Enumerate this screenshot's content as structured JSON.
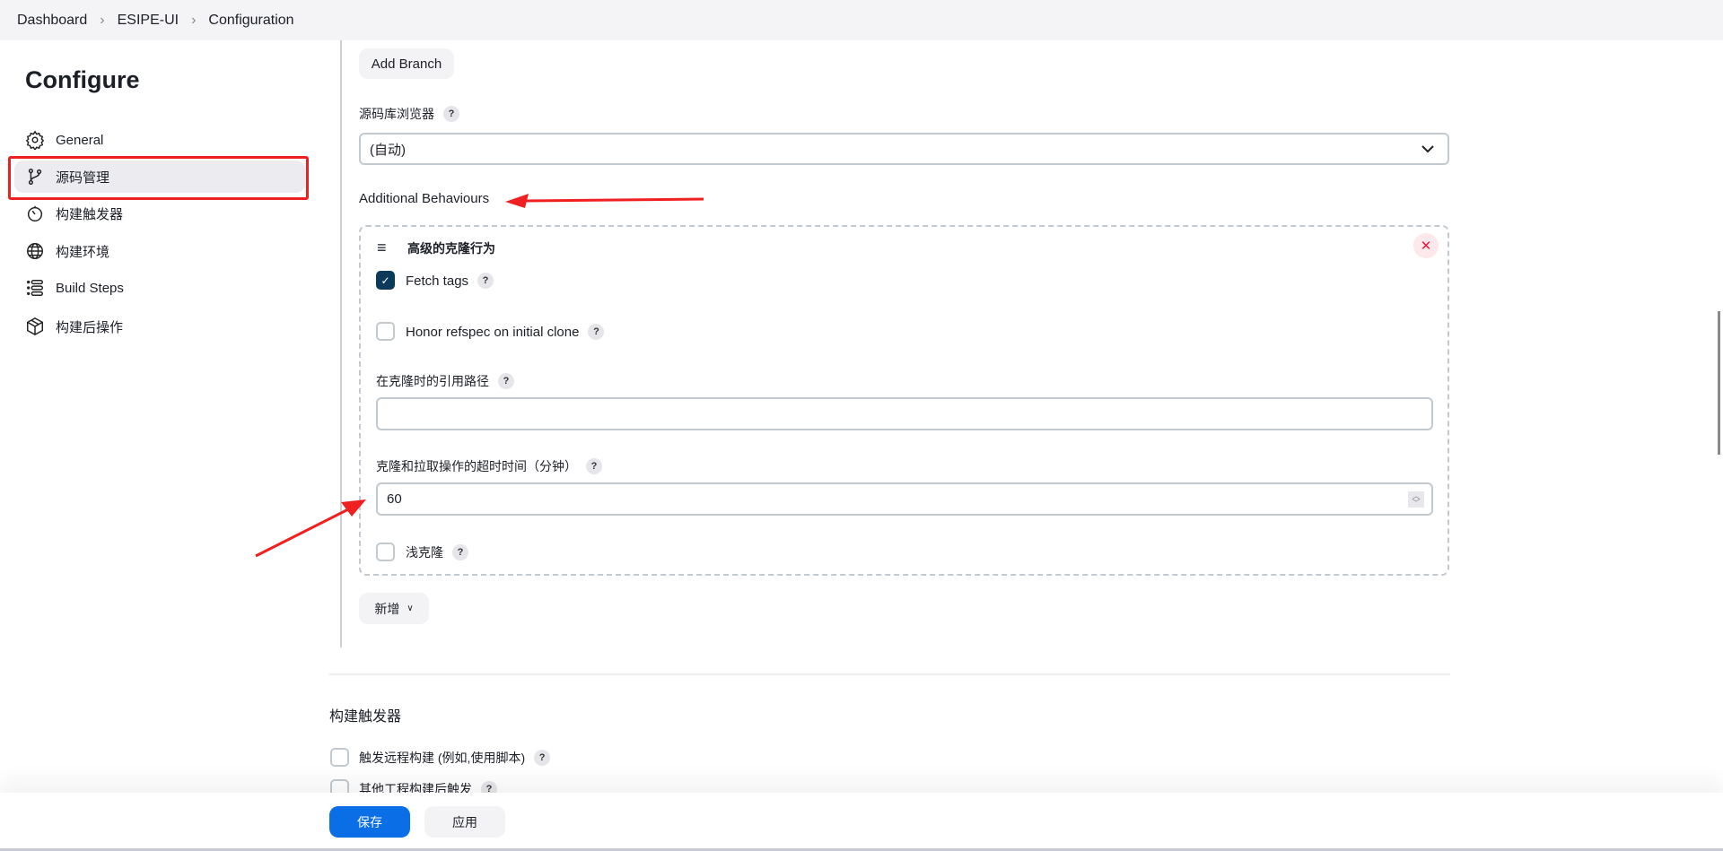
{
  "breadcrumb": [
    "Dashboard",
    "ESIPE-UI",
    "Configuration"
  ],
  "sidebar": {
    "title": "Configure",
    "items": [
      {
        "label": "General",
        "icon": "gear-icon"
      },
      {
        "label": "源码管理",
        "icon": "branch-icon",
        "active": true
      },
      {
        "label": "构建触发器",
        "icon": "timer-icon"
      },
      {
        "label": "构建环境",
        "icon": "globe-icon"
      },
      {
        "label": "Build Steps",
        "icon": "list-icon"
      },
      {
        "label": "构建后操作",
        "icon": "package-icon"
      }
    ]
  },
  "scm": {
    "add_branch": "Add Branch",
    "browser_label": "源码库浏览器",
    "browser_value": "(自动)",
    "additional_behaviours": "Additional Behaviours",
    "behaviour": {
      "title": "高级的克隆行为",
      "fetch_tags": "Fetch tags",
      "fetch_tags_checked": true,
      "honor_refspec": "Honor refspec on initial clone",
      "honor_refspec_checked": false,
      "reference_label": "在克隆时的引用路径",
      "reference_value": "",
      "timeout_label": "克隆和拉取操作的超时时间（分钟）",
      "timeout_value": "60",
      "shallow": "浅克隆",
      "shallow_checked": false
    },
    "add": "新增"
  },
  "triggers": {
    "title": "构建触发器",
    "items": [
      "触发远程构建 (例如,使用脚本)",
      "其他工程构建后触发"
    ]
  },
  "help": "?",
  "footer": {
    "save": "保存",
    "apply": "应用"
  },
  "colors": {
    "accent": "#0b3a5b",
    "primary": "#0a6ee6",
    "annotation": "#f02020"
  }
}
